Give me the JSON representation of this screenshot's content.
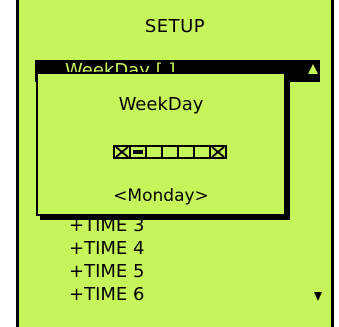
{
  "screen": {
    "title": "SETUP",
    "selected_item": "WeekDay [  ]",
    "list_items": [
      "+TIME 3",
      "+TIME 4",
      "+TIME 5",
      "+TIME 6"
    ]
  },
  "dialog": {
    "title": "WeekDay",
    "value": "<Monday>",
    "day_cells": [
      {
        "state": "x"
      },
      {
        "state": "selected"
      },
      {
        "state": "empty"
      },
      {
        "state": "empty"
      },
      {
        "state": "empty"
      },
      {
        "state": "empty"
      },
      {
        "state": "x"
      }
    ]
  },
  "icons": {
    "scroll_up": "triangle-up-icon",
    "scroll_down": "triangle-down-icon"
  },
  "colors": {
    "lcd_background": "#c6f45b",
    "foreground": "#000000"
  }
}
